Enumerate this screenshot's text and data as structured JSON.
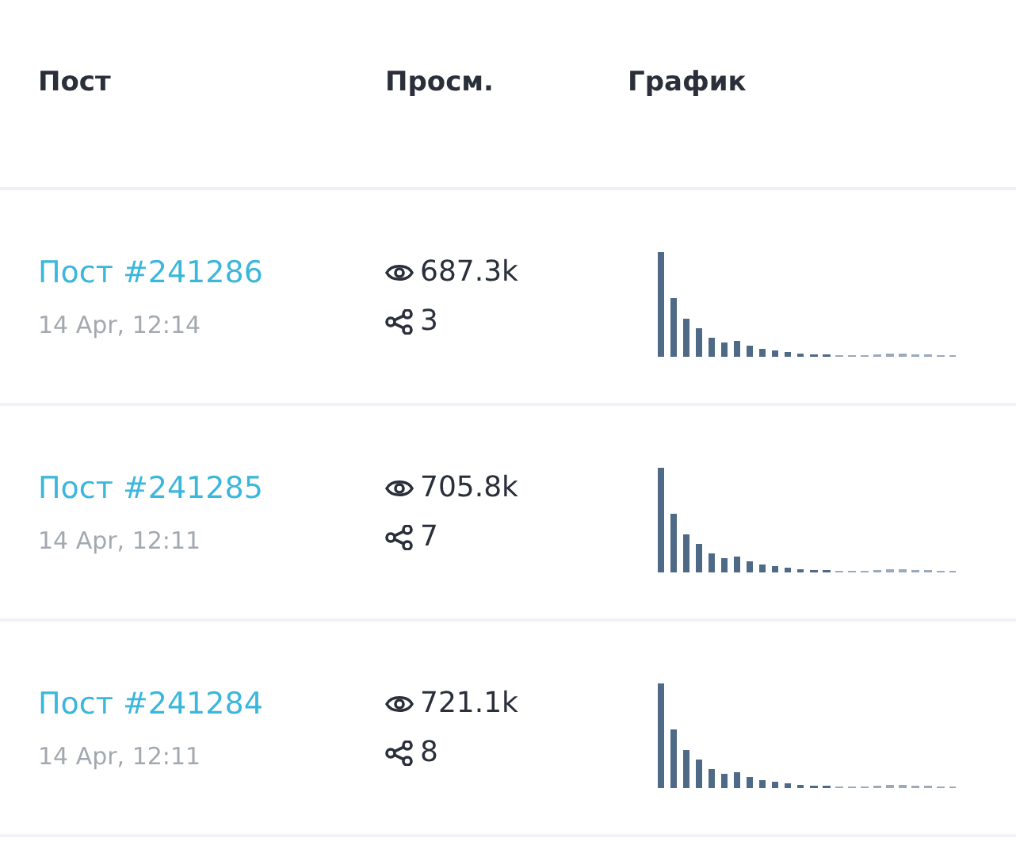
{
  "table": {
    "columns": [
      "Пост",
      "Просм.",
      "График"
    ],
    "rows": [
      {
        "post": "Пост #241286",
        "date": "14 Apr, 12:14",
        "views": "687.3k",
        "shares": "3"
      },
      {
        "post": "Пост #241285",
        "date": "14 Apr, 12:11",
        "views": "705.8k",
        "shares": "7"
      },
      {
        "post": "Пост #241284",
        "date": "14 Apr, 12:11",
        "views": "721.1k",
        "shares": "8"
      }
    ]
  }
}
